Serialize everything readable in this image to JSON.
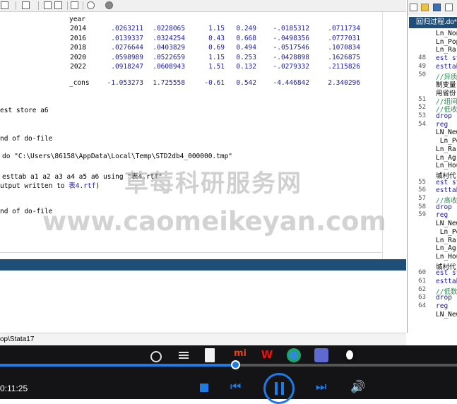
{
  "results": {
    "header_year": "year",
    "rows": [
      {
        "year": "2014",
        "v": [
          ".0263211",
          ".0228065",
          "1.15",
          "0.249",
          "-.0185312",
          ".0711734"
        ]
      },
      {
        "year": "2016",
        "v": [
          ".0139337",
          ".0324254",
          "0.43",
          "0.668",
          "-.0498356",
          ".0777031"
        ]
      },
      {
        "year": "2018",
        "v": [
          ".0276644",
          ".0403829",
          "0.69",
          "0.494",
          "-.0517546",
          ".1070834"
        ]
      },
      {
        "year": "2020",
        "v": [
          ".0598989",
          ".0522659",
          "1.15",
          "0.253",
          "-.0428898",
          ".1626875"
        ]
      },
      {
        "year": "2022",
        "v": [
          ".0918247",
          ".0608943",
          "1.51",
          "0.132",
          "-.0279332",
          ".2115826"
        ]
      }
    ],
    "cons_label": "_cons",
    "cons": [
      "-1.053273",
      "1.725558",
      "-0.61",
      "0.542",
      "-4.446842",
      "2.340296"
    ],
    "line_est_store": "est store a6",
    "line_end1": "nd of do-file",
    "line_do": "do \"C:\\Users\\86158\\AppData\\Local\\Temp\\STD2db4_000000.tmp\"",
    "line_esttab": "esttab a1 a2 a3 a4 a5 a6 using \"表4.rtf\"",
    "line_output_prefix": "utput written to ",
    "line_output_link": "表4.rtf",
    "line_output_suffix": ")",
    "line_end2": "nd of do-file"
  },
  "statusbar": {
    "path": "op\\Stata17"
  },
  "editor": {
    "tab": "回归过程.do*",
    "lines": [
      {
        "n": "",
        "t": "Ln_Non"
      },
      {
        "n": "",
        "t": "Ln_Pop"
      },
      {
        "n": "",
        "t": "Ln_Ra"
      },
      {
        "n": "48",
        "t": "est st"
      },
      {
        "n": "49",
        "t": "esttab"
      },
      {
        "n": "50",
        "t": "//异质"
      },
      {
        "n": "",
        "t": "制变量"
      },
      {
        "n": "",
        "t": "用省份"
      },
      {
        "n": "51",
        "t": "//组间"
      },
      {
        "n": "52",
        "t": "//低收"
      },
      {
        "n": "53",
        "t": "drop"
      },
      {
        "n": "54",
        "t": "reg"
      },
      {
        "n": "",
        "t": "LN_New"
      },
      {
        "n": "",
        "t": " Ln_Po"
      },
      {
        "n": "",
        "t": "Ln_Ra"
      },
      {
        "n": "",
        "t": "Ln_Ag"
      },
      {
        "n": "",
        "t": "Ln_Hou"
      },
      {
        "n": "",
        "t": "城村代"
      },
      {
        "n": "55",
        "t": "est st"
      },
      {
        "n": "56",
        "t": "esttab"
      },
      {
        "n": "57",
        "t": "//高收"
      },
      {
        "n": "58",
        "t": "drop"
      },
      {
        "n": "59",
        "t": "reg"
      },
      {
        "n": "",
        "t": "LN_New"
      },
      {
        "n": "",
        "t": " Ln_Po"
      },
      {
        "n": "",
        "t": "Ln_Ra"
      },
      {
        "n": "",
        "t": "Ln_Ag"
      },
      {
        "n": "",
        "t": "Ln_Hou"
      },
      {
        "n": "",
        "t": "城村代"
      },
      {
        "n": "60",
        "t": "est st"
      },
      {
        "n": "61",
        "t": "esttab"
      },
      {
        "n": "62",
        "t": "//低数"
      },
      {
        "n": "63",
        "t": "drop"
      },
      {
        "n": "64",
        "t": "reg"
      },
      {
        "n": "",
        "t": "LN_New"
      }
    ]
  },
  "player": {
    "time": "0:11:25",
    "progress": 0.52
  },
  "watermark": {
    "cn": "草莓科研服务网",
    "url": "www.caomeikeyan.com"
  },
  "colors": {
    "accent": "#1e7be6",
    "stata_blue": "#1a1aa6",
    "editor_tab": "#1f4e79"
  }
}
